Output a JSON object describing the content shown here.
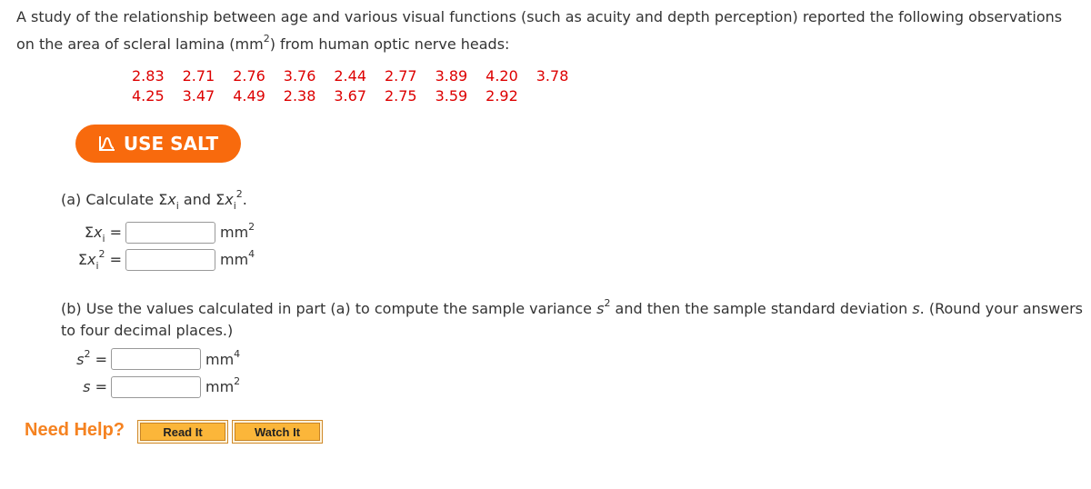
{
  "question": {
    "intro_1": "A study of the relationship between age and various visual functions (such as acuity and depth perception) reported the following observations on the area of scleral lamina (mm",
    "intro_sup": "2",
    "intro_2": ") from human optic nerve heads:",
    "data_row_1": [
      "2.83",
      "2.71",
      "2.76",
      "3.76",
      "2.44",
      "2.77",
      "3.89",
      "4.20",
      "3.78"
    ],
    "data_row_2": [
      "4.25",
      "3.47",
      "4.49",
      "2.38",
      "3.67",
      "2.75",
      "3.59",
      "2.92"
    ],
    "data_color": "#dd0000"
  },
  "salt_button": {
    "label": "USE SALT",
    "color": "#f86a0d",
    "icon": "bell-curve-icon"
  },
  "part_a": {
    "prompt_1": "(a) Calculate Σ",
    "x": "x",
    "i": "i",
    "and": " and Σ",
    "two": "2",
    "period": ".",
    "sum_label": "Σ",
    "eq": " =",
    "sum_x_value": "",
    "sum_x_unit": "mm",
    "sum_x_unit_exp": "2",
    "sum_x2_value": "",
    "sum_x2_unit": "mm",
    "sum_x2_unit_exp": "4"
  },
  "part_b": {
    "prompt_1": "(b) Use the values calculated in part (a) to compute the sample variance ",
    "s": "s",
    "two": "2",
    "prompt_2": " and then the sample standard deviation ",
    "prompt_3": ". (Round your answers to four decimal places.)",
    "s2_label_exp": "2",
    "eq": " =",
    "s2_value": "",
    "s2_unit": "mm",
    "s2_unit_exp": "4",
    "s_value": "",
    "s_unit": "mm",
    "s_unit_exp": "2"
  },
  "help": {
    "label": "Need Help?",
    "read_it": "Read It",
    "watch_it": "Watch It"
  }
}
